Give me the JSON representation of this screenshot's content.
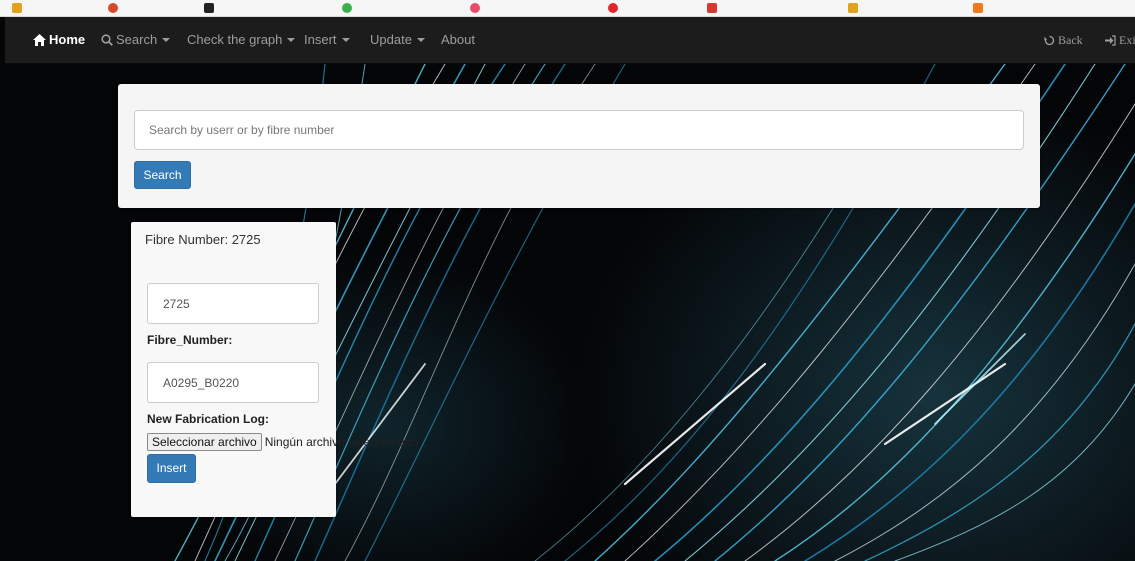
{
  "nav": {
    "home": "Home",
    "search": "Search",
    "check_graph": "Check the graph",
    "insert": "Insert",
    "update": "Update",
    "about": "About",
    "back": "Back",
    "exit": "Exit"
  },
  "search": {
    "placeholder": "Search by userr or by fibre number",
    "button": "Search"
  },
  "fibre_panel": {
    "title": "Fibre Number: 2725",
    "id_value": "2725",
    "fibre_number_label": "Fibre_Number:",
    "fibre_number_value": "A0295_B0220",
    "log_label": "New Fabrication Log:",
    "file_button": "Seleccionar archivo",
    "file_status": "Ningún archivo seleccionado",
    "insert_button": "Insert"
  },
  "colors": {
    "navbar": "#1c1c1c",
    "primary": "#337ab7",
    "panel": "#f5f5f5"
  },
  "icons": {
    "home": "home-icon",
    "search": "search-icon",
    "back": "back-icon",
    "exit": "exit-icon"
  }
}
